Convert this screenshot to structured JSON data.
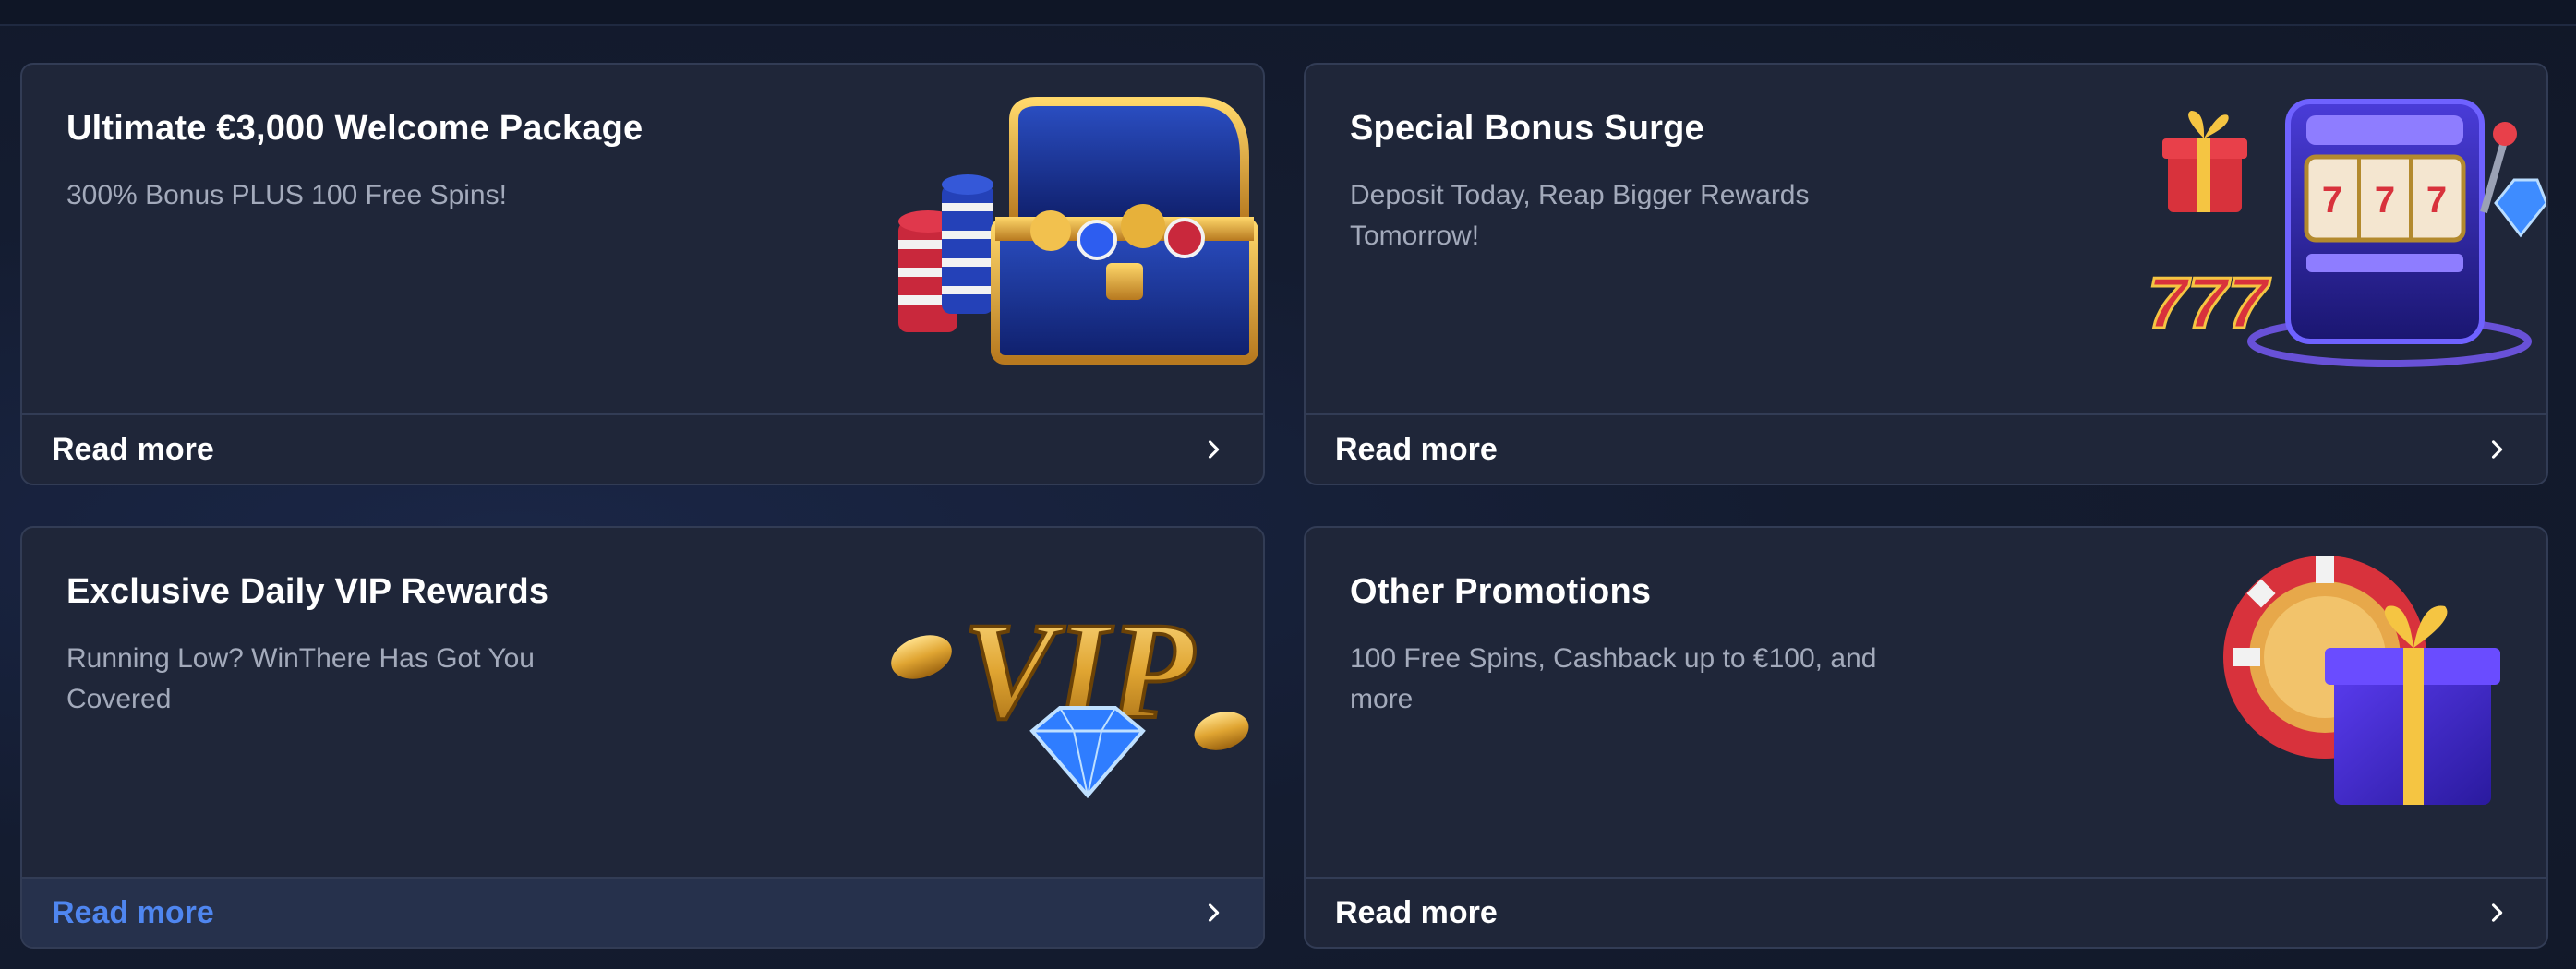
{
  "colors": {
    "background": "#121a2c",
    "card": "#1f2639",
    "card_border": "#323c55",
    "title": "#ffffff",
    "subtitle": "#a3aabb",
    "link_active": "#4f86f0"
  },
  "cards": [
    {
      "title": "Ultimate €3,000 Welcome Package",
      "subtitle": "300% Bonus PLUS 100 Free Spins!",
      "art": "treasure-chest-with-casino-chips",
      "link_label": "Read more",
      "link_state": "default"
    },
    {
      "title": "Special Bonus Surge",
      "subtitle": "Deposit Today, Reap Bigger Rewards Tomorrow!",
      "art": "slot-machine-with-gift-and-777",
      "link_label": "Read more",
      "link_state": "default"
    },
    {
      "title": "Exclusive Daily VIP Rewards",
      "subtitle": "Running Low? WinThere Has Got You Covered",
      "art": "gold-vip-letters-with-diamond",
      "link_label": "Read more",
      "link_state": "hover"
    },
    {
      "title": "Other Promotions",
      "subtitle": "100 Free Spins, Cashback up to €100, and more",
      "art": "casino-chip-with-gift-box",
      "link_label": "Read more",
      "link_state": "default"
    }
  ]
}
